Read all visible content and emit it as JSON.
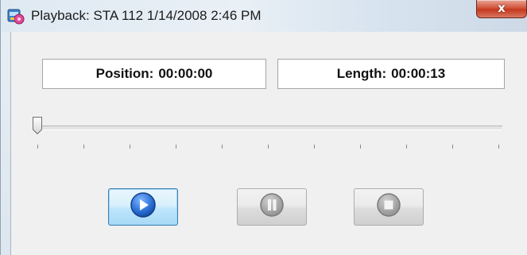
{
  "window": {
    "title": "Playback: STA 112 1/14/2008 2:46 PM",
    "close_glyph": "x",
    "app_icon": "recorder-app-icon"
  },
  "info": {
    "position_label": "Position:",
    "position_value": "00:00:00",
    "length_label": "Length:",
    "length_value": "00:00:13"
  },
  "slider": {
    "value_fraction": 0.0,
    "tick_count": 11
  },
  "controls": {
    "play": {
      "icon": "play-icon",
      "enabled": true,
      "color": "#2a6fd6"
    },
    "pause": {
      "icon": "pause-icon",
      "enabled": false,
      "color": "#9a9a9a"
    },
    "stop": {
      "icon": "stop-icon",
      "enabled": false,
      "color": "#9a9a9a"
    }
  }
}
